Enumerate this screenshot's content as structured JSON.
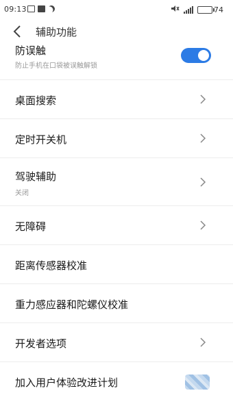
{
  "status_bar": {
    "time": "09:13",
    "battery": "74",
    "battery_fraction": 0.74
  },
  "header": {
    "title": "辅助功能",
    "back_icon": "chevron-left-icon"
  },
  "rows": [
    {
      "title": "防误触",
      "subtitle": "防止手机在口袋被误触解锁",
      "control": "toggle",
      "toggle_on": true
    },
    {
      "title": "桌面搜索",
      "control": "chevron"
    },
    {
      "title": "定时开关机",
      "control": "chevron"
    },
    {
      "title": "驾驶辅助",
      "subtitle": "关闭",
      "control": "chevron"
    },
    {
      "title": "无障碍",
      "control": "chevron"
    },
    {
      "title": "距离传感器校准",
      "control": "none"
    },
    {
      "title": "重力感应器和陀螺仪校准",
      "control": "none"
    },
    {
      "title": "开发者选项",
      "control": "chevron"
    },
    {
      "title": "加入用户体验改进计划",
      "control": "toggle-obscured"
    }
  ],
  "colors": {
    "accent": "#2c7be5",
    "divider": "#ececec",
    "subtitle": "#999999"
  }
}
